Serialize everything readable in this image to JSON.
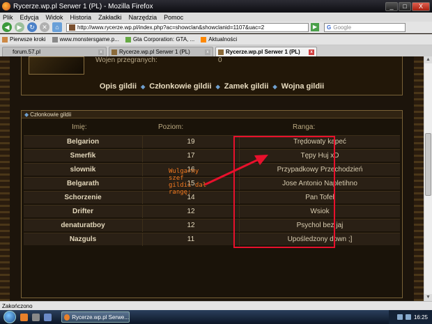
{
  "window": {
    "title": "Rycerze.wp.pl Serwer 1 (PL) - Mozilla Firefox",
    "controls": [
      "_",
      "□",
      "X"
    ]
  },
  "menu": [
    "Plik",
    "Edycja",
    "Widok",
    "Historia",
    "Zakładki",
    "Narzędzia",
    "Pomoc"
  ],
  "navbar": {
    "url": "http://www.rycerze.wp.pl/index.php?ac=showclan&showclanid=1107&uac=2",
    "search_placeholder": "Google",
    "search_engine": "G"
  },
  "bookmarks": [
    "Pierwsze kroki",
    "www.monstersgame.p...",
    "Gta Corporation: GTA, ...",
    "Aktualności"
  ],
  "tabs": [
    {
      "label": "forum.57.pl",
      "active": false
    },
    {
      "label": "Rycerze.wp.pl Serwer 1 (PL)",
      "active": false
    },
    {
      "label": "Rycerze.wp.pl Serwer 1 (PL)",
      "active": true
    }
  ],
  "top_panel": {
    "label": "Wojen przegranych:",
    "value": "0"
  },
  "guild_nav": [
    "Opis gildii",
    "Członkowie gildii",
    "Zamek gildii",
    "Wojna gildii"
  ],
  "members": {
    "header": "Członkowie gildii",
    "columns": [
      "Imię:",
      "Poziom:",
      "Ranga:"
    ],
    "rows": [
      {
        "name": "Belgarion",
        "level": "19",
        "rank": "Trędowaty kapeć"
      },
      {
        "name": "Smerfik",
        "level": "17",
        "rank": "Tępy Huj xD"
      },
      {
        "name": "slownik",
        "level": "16",
        "rank": "Przypadkowy Przechodzień"
      },
      {
        "name": "Belgarath",
        "level": "15",
        "rank": "Jose Antonio Napletihno"
      },
      {
        "name": "Schorzenie",
        "level": "14",
        "rank": "Pan Tofel"
      },
      {
        "name": "Drifter",
        "level": "12",
        "rank": "Wsiok"
      },
      {
        "name": "denaturatboy",
        "level": "12",
        "rank": "Psychol bez jaj"
      },
      {
        "name": "Nazguls",
        "level": "11",
        "rank": "Upośledzony down ;]"
      }
    ]
  },
  "annotation": {
    "text": "Wulgarny\nszef\ngildii dał\nrangę:",
    "color": "#f07820",
    "box_color": "#e8102c"
  },
  "status": "Zakończono",
  "taskbar": {
    "item": "Rycerze.wp.pl Serwe...",
    "clock": "16:25"
  }
}
